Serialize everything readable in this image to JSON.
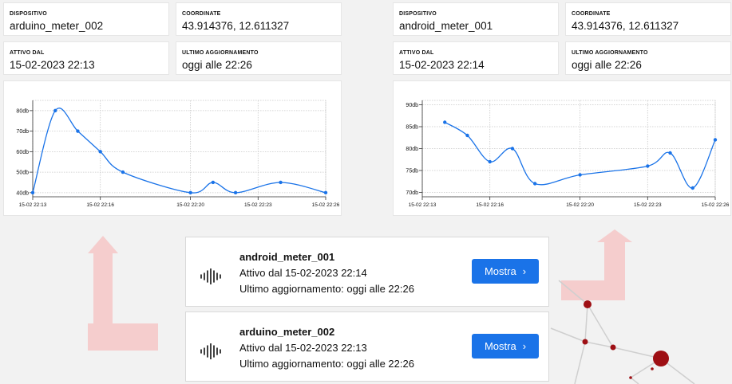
{
  "left": {
    "dispositivo_label": "DISPOSITIVO",
    "dispositivo_value": "arduino_meter_002",
    "coordinate_label": "COORDINATE",
    "coordinate_value": "43.914376, 12.611327",
    "attivo_label": "ATTIVO DAL",
    "attivo_value": "15-02-2023 22:13",
    "aggiornamento_label": "ULTIMO AGGIORNAMENTO",
    "aggiornamento_value": "oggi alle 22:26"
  },
  "right": {
    "dispositivo_label": "DISPOSITIVO",
    "dispositivo_value": "android_meter_001",
    "coordinate_label": "COORDINATE",
    "coordinate_value": "43.914376, 12.611327",
    "attivo_label": "ATTIVO DAL",
    "attivo_value": "15-02-2023 22:14",
    "aggiornamento_label": "ULTIMO AGGIORNAMENTO",
    "aggiornamento_value": "oggi alle 22:26"
  },
  "chart_data": [
    {
      "type": "line",
      "x_ticks": [
        "15-02 22:13",
        "15-02 22:16",
        "15-02 22:20",
        "15-02 22:23",
        "15-02 22:26"
      ],
      "y_ticks": [
        "40db",
        "50db",
        "60db",
        "70db",
        "80db"
      ],
      "ylim": [
        38,
        85
      ],
      "grid": true,
      "line_color": "#1a73e8",
      "x": [
        "22:13:00",
        "22:14:00",
        "22:15:00",
        "22:16:00",
        "22:17:00",
        "22:20:00",
        "22:21:00",
        "22:22:00",
        "22:24:00",
        "22:26:00"
      ],
      "values": [
        40,
        80,
        70,
        60,
        50,
        40,
        45,
        40,
        45,
        40
      ]
    },
    {
      "type": "line",
      "x_ticks": [
        "15-02 22:13",
        "15-02 22:16",
        "15-02 22:20",
        "15-02 22:23",
        "15-02 22:26"
      ],
      "y_ticks": [
        "70db",
        "75db",
        "80db",
        "85db",
        "90db"
      ],
      "ylim": [
        69,
        91
      ],
      "grid": true,
      "line_color": "#1a73e8",
      "x": [
        "22:14:00",
        "22:15:00",
        "22:16:00",
        "22:17:00",
        "22:18:00",
        "22:20:00",
        "22:23:00",
        "22:24:00",
        "22:25:00",
        "22:26:00"
      ],
      "values": [
        86,
        83,
        77,
        80,
        72,
        74,
        76,
        79,
        71,
        82
      ]
    }
  ],
  "devices": [
    {
      "name": "android_meter_001",
      "attivo": "Attivo dal 15-02-2023 22:14",
      "aggiornamento": "Ultimo aggiornamento: oggi alle 22:26",
      "button": "Mostra",
      "icon": "sound-wave-icon"
    },
    {
      "name": "arduino_meter_002",
      "attivo": "Attivo dal 15-02-2023 22:13",
      "aggiornamento": "Ultimo aggiornamento: oggi alle 22:26",
      "button": "Mostra",
      "icon": "sound-wave-icon"
    }
  ],
  "colors": {
    "accent": "#1a73e8",
    "arrow": "#f5c9c9",
    "network_node": "#9e0f14"
  }
}
